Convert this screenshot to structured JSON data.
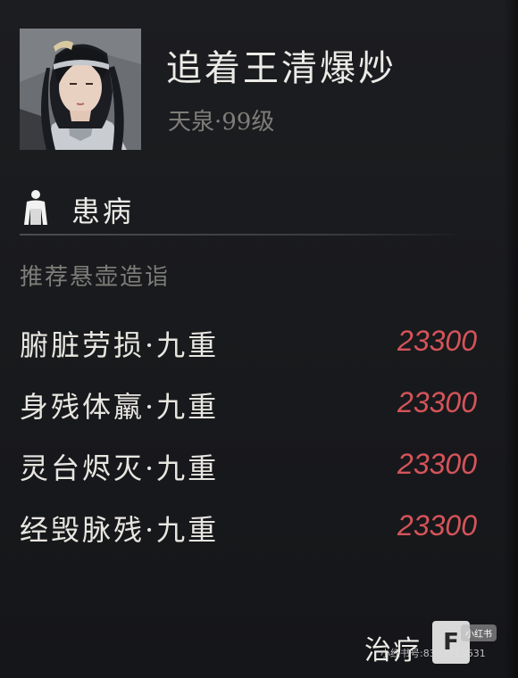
{
  "character": {
    "name": "追着王清爆炒",
    "level_text": "天泉·99级"
  },
  "status": {
    "icon": "body-icon",
    "title": "患病",
    "subtitle": "推荐悬壶造诣"
  },
  "ailments": [
    {
      "label": "腑脏劳损·九重",
      "value": "23300"
    },
    {
      "label": "身残体羸·九重",
      "value": "23300"
    },
    {
      "label": "灵台烬灭·九重",
      "value": "23300"
    },
    {
      "label": "经毁脉残·九重",
      "value": "23300"
    }
  ],
  "action": {
    "label": "治疗",
    "key": "F"
  },
  "watermark": {
    "logo": "小红书",
    "id": "小红书号:8303719631"
  },
  "colors": {
    "background": "#1a1b1e",
    "value_red": "#d4545a",
    "muted_text": "#7e7d79"
  }
}
